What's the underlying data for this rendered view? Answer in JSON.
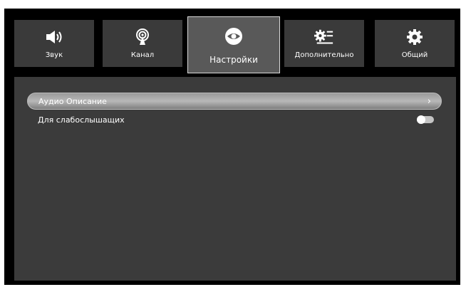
{
  "tabs": [
    {
      "label": "Звук",
      "icon": "speaker-icon",
      "active": false
    },
    {
      "label": "Канал",
      "icon": "antenna-icon",
      "active": false
    },
    {
      "label": "Настройки",
      "icon": "eye-icon",
      "active": true
    },
    {
      "label": "Дополнительно",
      "icon": "gear-list-icon",
      "active": false
    },
    {
      "label": "Общий",
      "icon": "gear-icon",
      "active": false
    }
  ],
  "settings": {
    "items": [
      {
        "label": "Аудио Описание",
        "control": "chevron-right",
        "selected": true
      },
      {
        "label": "Для слабослышащих",
        "control": "toggle",
        "toggle_on": false
      }
    ],
    "chevron": "›"
  },
  "colors": {
    "background": "#000000",
    "tab": "#3a3a3a",
    "tab_active": "#595959",
    "panel": "#3b3b3b",
    "highlight": "#b0b0b0"
  }
}
